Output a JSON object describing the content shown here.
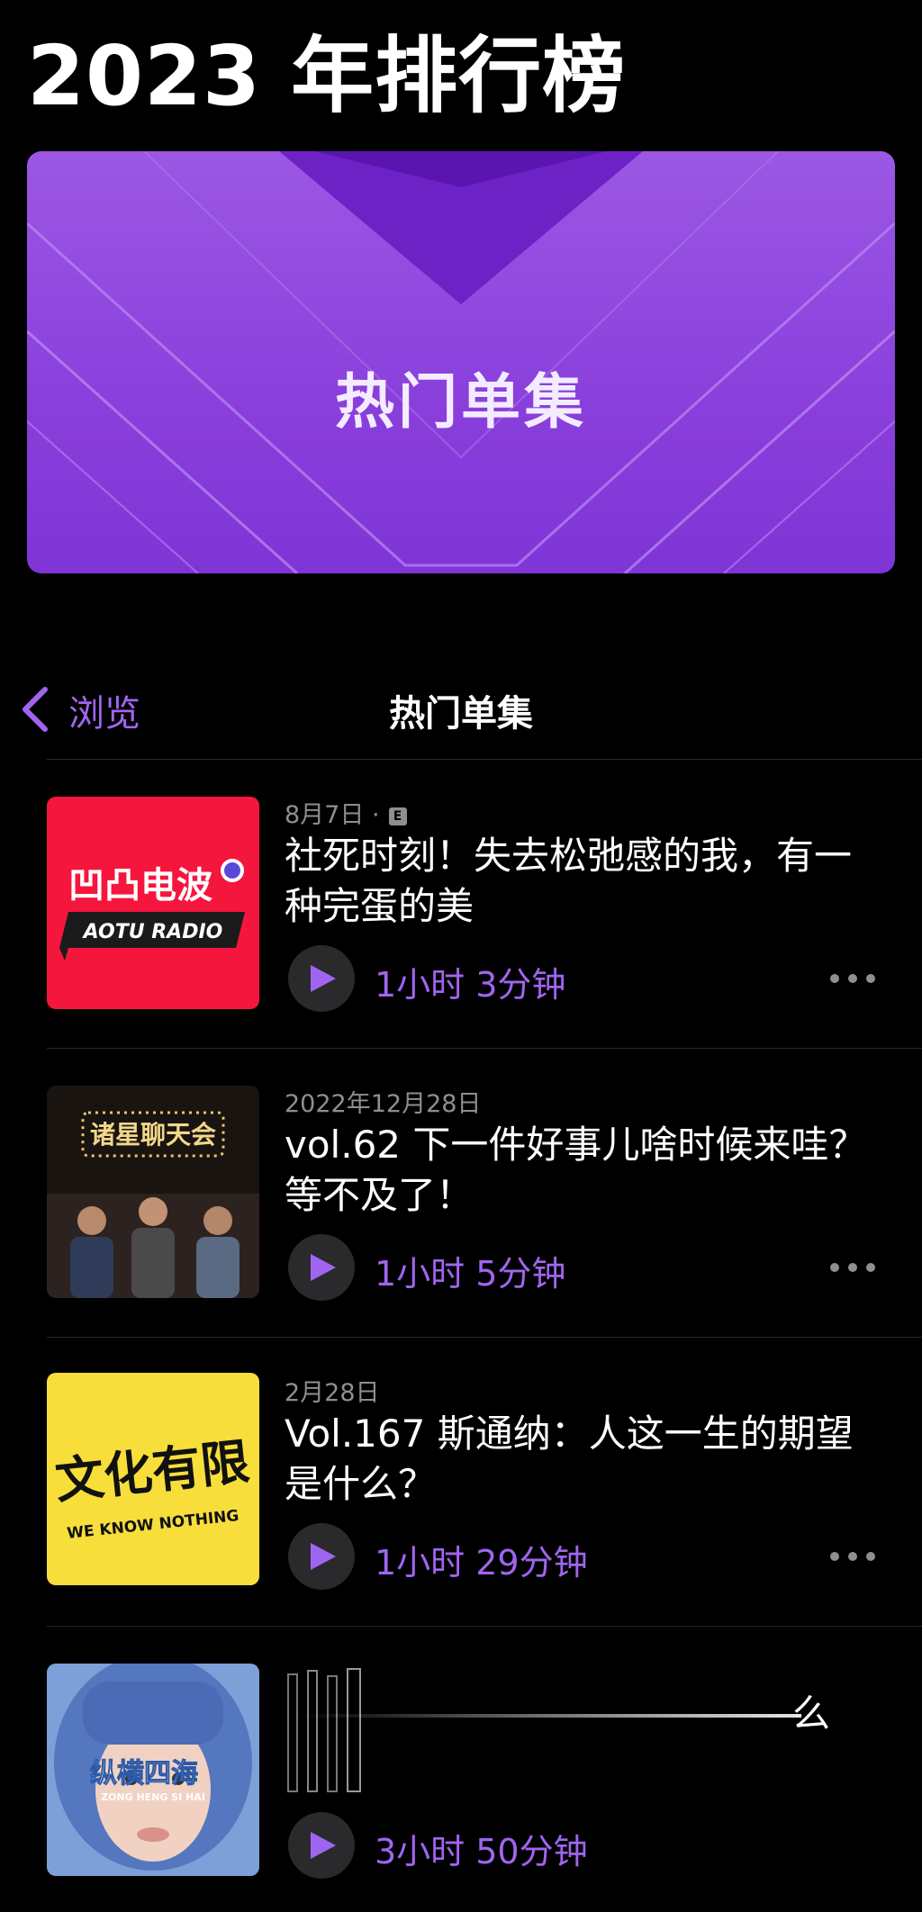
{
  "page": {
    "title": "2023 年排行榜"
  },
  "banner": {
    "title": "热门单集"
  },
  "nav": {
    "back_label": "浏览",
    "title": "热门单集"
  },
  "colors": {
    "accent": "#a065f0",
    "banner": "#8a3fdc",
    "background": "#000000",
    "secondary_text": "#8e8e93"
  },
  "episodes": [
    {
      "date": "8月7日",
      "explicit": "E",
      "title": "社死时刻！失去松弛感的我，有一种完蛋的美",
      "duration": "1小时 3分钟",
      "art": {
        "name": "凹凸电波",
        "sub": "AOTU RADIO"
      }
    },
    {
      "date": "2022年12月28日",
      "title": "vol.62 下一件好事儿啥时候来哇？等不及了！",
      "duration": "1小时 5分钟",
      "art": {
        "name": "诸星聊天会"
      }
    },
    {
      "date": "2月28日",
      "title": "Vol.167 斯通纳：人这一生的期望是什么？",
      "duration": "1小时 29分钟",
      "art": {
        "name": "文化有限",
        "sub": "WE KNOW NOTHING"
      }
    },
    {
      "title": "么",
      "duration": "3小时 50分钟",
      "art": {
        "name": "纵横四海",
        "sub": "ZONG HENG SI HAI"
      }
    }
  ]
}
